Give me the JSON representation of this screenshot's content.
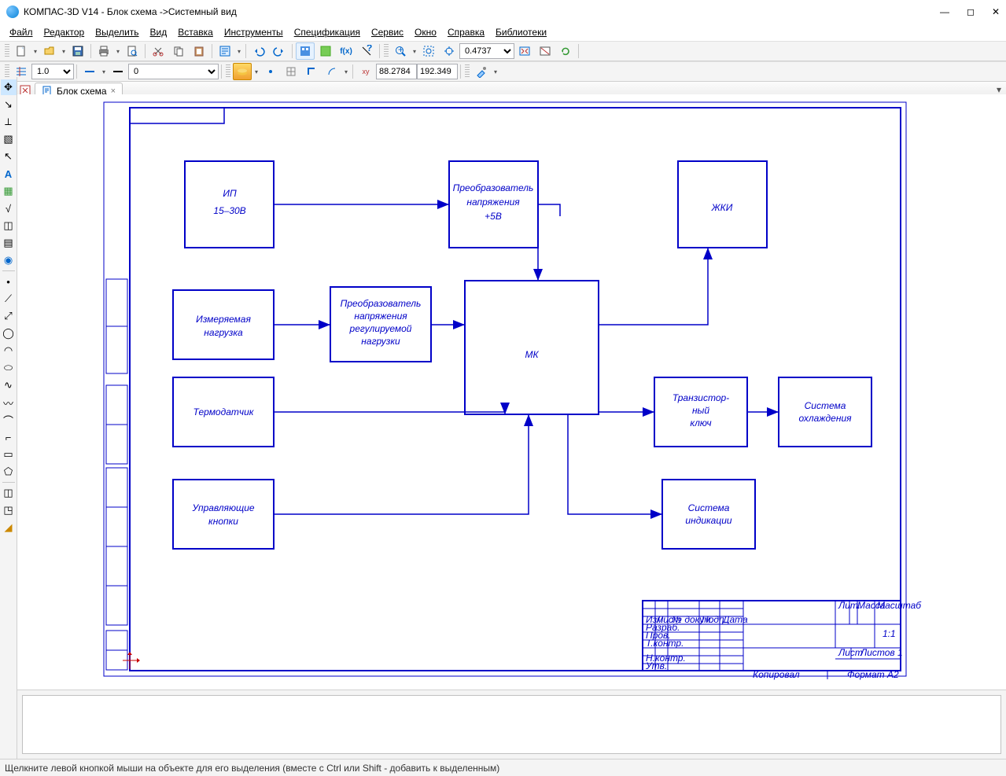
{
  "title": "КОМПАС-3D V14 - Блок схема ->Системный вид",
  "menu": [
    "Файл",
    "Редактор",
    "Выделить",
    "Вид",
    "Вставка",
    "Инструменты",
    "Спецификация",
    "Сервис",
    "Окно",
    "Справка",
    "Библиотеки"
  ],
  "toolbar1": {
    "zoom": "0.4737"
  },
  "toolbar2": {
    "scale": "1.0",
    "style": "0",
    "layer": "0",
    "coord_x": "88.2784",
    "coord_y": "192.349"
  },
  "tab": {
    "name": "Блок схема"
  },
  "status": "Щелкните левой кнопкой мыши на объекте для его выделения (вместе с Ctrl или Shift - добавить к выделенным)",
  "diagram": {
    "blocks": {
      "ip": [
        "ИП",
        "15–30В"
      ],
      "conv5v": [
        "Преобразователь",
        "напряжения",
        "+5В"
      ],
      "lcd": [
        "ЖКИ"
      ],
      "load": [
        "Измеряемая",
        "нагрузка"
      ],
      "conv_reg": [
        "Преобразователь",
        "напряжения",
        "регулируемой",
        "нагрузки"
      ],
      "mk": [
        "МК"
      ],
      "thermo": [
        "Термодатчик"
      ],
      "tkey": [
        "Транзистор-",
        "ный",
        "ключ"
      ],
      "cooling": [
        "Система",
        "охлаждения"
      ],
      "buttons": [
        "Управляющие",
        "кнопки"
      ],
      "indic": [
        "Система",
        "индикации"
      ]
    },
    "stamp": {
      "cols": [
        "Изм",
        "Лист",
        "№ докум.",
        "Подп.",
        "Дата"
      ],
      "rows": [
        "Разраб.",
        "Пров.",
        "Т.контр.",
        "Н.контр.",
        "Утв."
      ],
      "lit": "Лит.",
      "mass": "Масса",
      "scale_lbl": "Масштаб",
      "scale": "1:1",
      "sheet": "Лист",
      "sheets": "Листов   1",
      "copy": "Копировал",
      "format": "Формат   А2"
    }
  }
}
